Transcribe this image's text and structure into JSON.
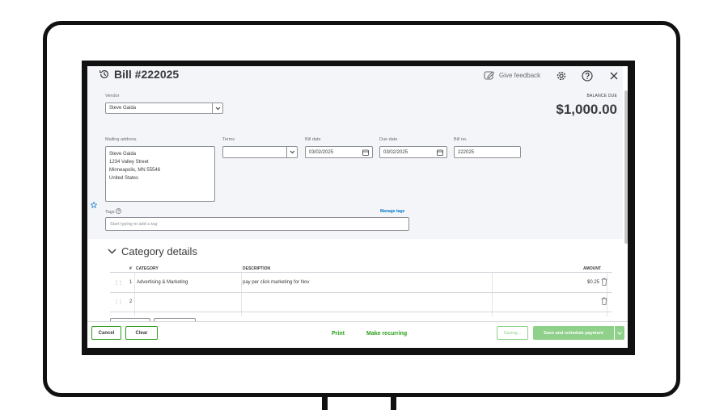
{
  "bill": {
    "title": "Bill #222025",
    "give_feedback": "Give feedback",
    "balance_due_label": "BALANCE DUE",
    "balance_due": "$1,000.00"
  },
  "vendor": {
    "label": "Vendor",
    "value": "Steve Gaida"
  },
  "mailing": {
    "label": "Mailing address",
    "lines": [
      "Steve Gaida",
      "1234 Valley Street",
      "Minneapolis, MN 55546",
      "United States"
    ]
  },
  "terms": {
    "label": "Terms",
    "value": ""
  },
  "bill_date": {
    "label": "Bill date",
    "value": "03/02/2025"
  },
  "due_date": {
    "label": "Due date",
    "value": "03/02/2025"
  },
  "bill_no": {
    "label": "Bill no.",
    "value": "222025"
  },
  "tags": {
    "label": "Tags",
    "placeholder": "Start typing to add a tag",
    "manage": "Manage tags"
  },
  "category": {
    "title": "Category details",
    "columns": {
      "num": "#",
      "category": "CATEGORY",
      "description": "DESCRIPTION",
      "amount": "AMOUNT"
    },
    "rows": [
      {
        "num": "1",
        "category": "Advertising & Marketing",
        "description": "pay per click marketing for Nov",
        "amount": "$0.25"
      },
      {
        "num": "2",
        "category": "",
        "description": "",
        "amount": ""
      }
    ]
  },
  "footer": {
    "cancel": "Cancel",
    "clear": "Clear",
    "print": "Print",
    "make_recurring": "Make recurring",
    "saving": "Saving...",
    "save_schedule": "Save and schedule payment"
  },
  "colors": {
    "accent_green": "#2ca01c",
    "disabled_green": "#8fd08a",
    "link_blue": "#0077c5"
  }
}
